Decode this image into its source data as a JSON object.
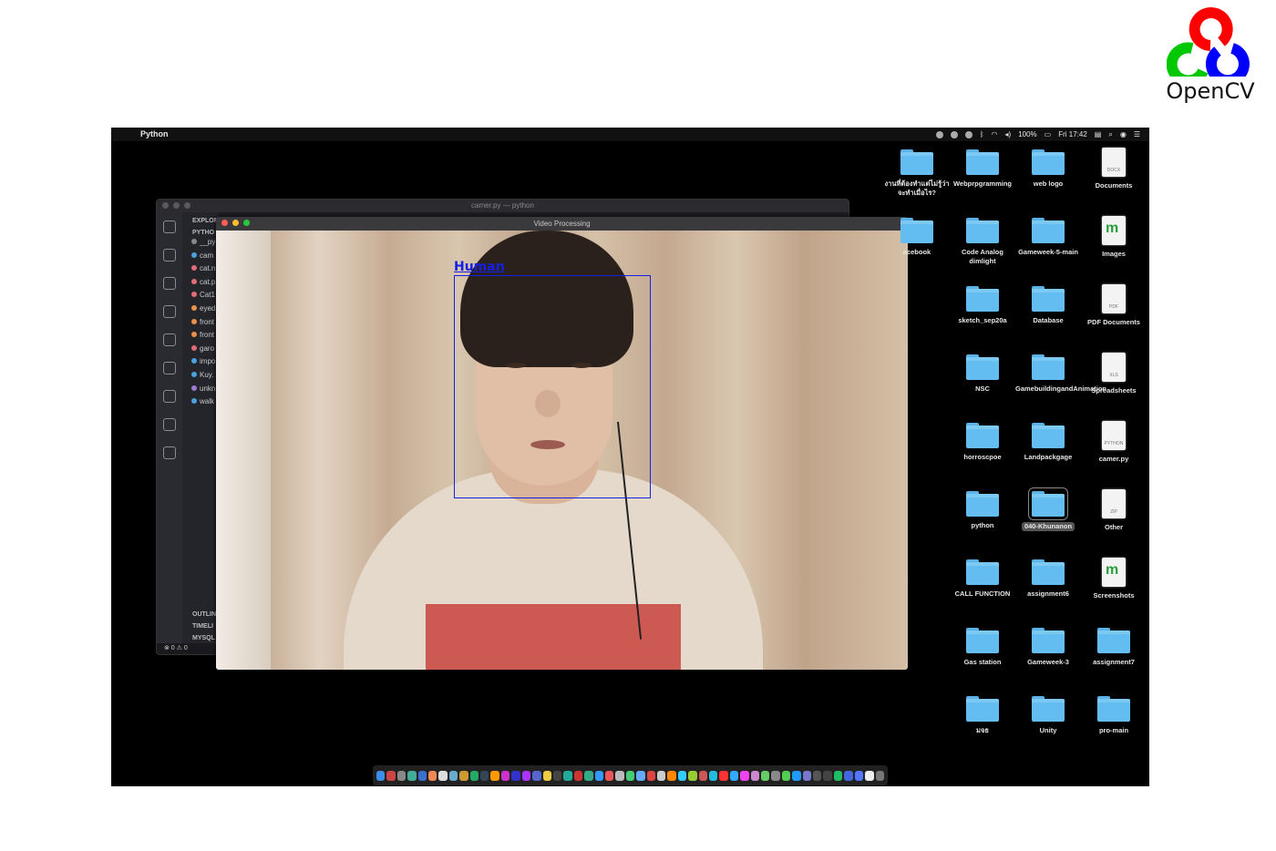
{
  "logo": {
    "text": "OpenCV",
    "colors": [
      "#ff0000",
      "#00c800",
      "#0000ff"
    ]
  },
  "menubar": {
    "app_name": "Python",
    "battery": "100%",
    "clock": "Fri 17:42"
  },
  "vscode": {
    "title": "camer.py — python",
    "explorer_label": "EXPLOR",
    "section_label": "PYTHO",
    "files": [
      {
        "name": "__py",
        "color": "#888888"
      },
      {
        "name": "cam",
        "color": "#4aa3df"
      },
      {
        "name": "cat.n",
        "color": "#e06c75"
      },
      {
        "name": "cat.p",
        "color": "#e06c75"
      },
      {
        "name": "Cat1",
        "color": "#e06c75"
      },
      {
        "name": "eyed",
        "color": "#e8904c"
      },
      {
        "name": "front",
        "color": "#e8904c"
      },
      {
        "name": "front",
        "color": "#e8904c"
      },
      {
        "name": "garo",
        "color": "#e06c75"
      },
      {
        "name": "impo",
        "color": "#4aa3df"
      },
      {
        "name": "Kuy.",
        "color": "#4aa3df"
      },
      {
        "name": "unkn",
        "color": "#9a7dd0"
      },
      {
        "name": "walk",
        "color": "#4aa3df"
      }
    ],
    "bottom_sections": [
      "OUTLIN",
      "TIMELI",
      "MYSQL"
    ],
    "status": "⊗ 0 ⚠ 0"
  },
  "video": {
    "title": "Video Processing",
    "detection_label": "Human",
    "detection_color": "#1420e6"
  },
  "desktop_icons": [
    {
      "label": "งานที่ต้องทำแต่ไม่รู้ว่าจะทำเมื่อไร?",
      "type": "folder"
    },
    {
      "label": "Webprpgramming",
      "type": "folder"
    },
    {
      "label": "web logo",
      "type": "folder"
    },
    {
      "label": "Documents",
      "type": "doc",
      "ext": "DOCX"
    },
    {
      "label": "acebook",
      "type": "folder"
    },
    {
      "label": "Code Analog dimlight",
      "type": "folder"
    },
    {
      "label": "Gameweek-5-main",
      "type": "folder"
    },
    {
      "label": "Images",
      "type": "mdoc",
      "ext": ""
    },
    {
      "label": "",
      "type": "none"
    },
    {
      "label": "sketch_sep20a",
      "type": "folder"
    },
    {
      "label": "Database",
      "type": "folder"
    },
    {
      "label": "PDF Documents",
      "type": "doc",
      "ext": "PDF"
    },
    {
      "label": "",
      "type": "none"
    },
    {
      "label": "NSC",
      "type": "folder"
    },
    {
      "label": "GamebuildingandAnimation",
      "type": "folder"
    },
    {
      "label": "Spreadsheets",
      "type": "doc",
      "ext": "XLS"
    },
    {
      "label": "",
      "type": "none"
    },
    {
      "label": "horroscpoe",
      "type": "folder"
    },
    {
      "label": "Landpackgage",
      "type": "folder"
    },
    {
      "label": "camer.py",
      "type": "doc",
      "ext": "PYTHON"
    },
    {
      "label": "",
      "type": "none"
    },
    {
      "label": "python",
      "type": "folder"
    },
    {
      "label": "040-Khunanon",
      "type": "folder",
      "selected": true
    },
    {
      "label": "Other",
      "type": "doc",
      "ext": "ZIP"
    },
    {
      "label": "",
      "type": "none"
    },
    {
      "label": "CALL FUNCTION",
      "type": "folder"
    },
    {
      "label": "assignment6",
      "type": "folder"
    },
    {
      "label": "Screenshots",
      "type": "mdoc",
      "ext": ""
    },
    {
      "label": "",
      "type": "none"
    },
    {
      "label": "Gas station",
      "type": "folder"
    },
    {
      "label": "Gameweek-3",
      "type": "folder"
    },
    {
      "label": "assignment7",
      "type": "folder"
    },
    {
      "label": "",
      "type": "none"
    },
    {
      "label": "มจธ",
      "type": "folder"
    },
    {
      "label": "Unity",
      "type": "folder"
    },
    {
      "label": "pro-main",
      "type": "folder"
    }
  ],
  "dock_colors": [
    "#3c8ee8",
    "#c44",
    "#888",
    "#4a9",
    "#3b6fd0",
    "#e85",
    "#ddd",
    "#6ac",
    "#c93",
    "#2a6",
    "#345",
    "#f90",
    "#c3c",
    "#33c",
    "#a3f",
    "#56c",
    "#ec4",
    "#444",
    "#2a9",
    "#c33",
    "#3a8",
    "#39f",
    "#e55",
    "#bbb",
    "#4c7",
    "#6af",
    "#d44",
    "#ccc",
    "#f80",
    "#3cf",
    "#9c3",
    "#c55",
    "#2bd",
    "#f33",
    "#3af",
    "#e4e",
    "#c8c",
    "#6c6",
    "#888",
    "#5c5",
    "#29f",
    "#77c",
    "#555",
    "#444",
    "#2b6",
    "#46d",
    "#57f",
    "#eee",
    "#777"
  ]
}
